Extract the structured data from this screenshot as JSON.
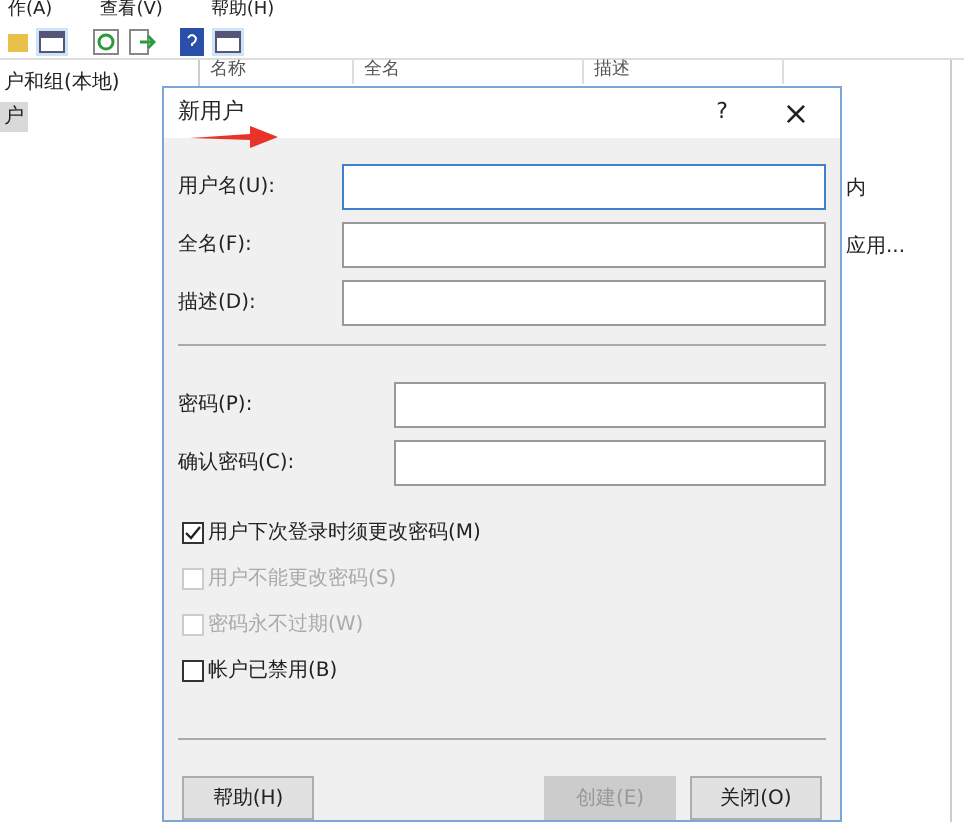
{
  "menu": [
    "作(A)",
    "查看(V)",
    "帮助(H)"
  ],
  "tree": [
    {
      "label": "户和组(本地)",
      "selected": false
    },
    {
      "label": "户",
      "selected": true
    }
  ],
  "list": {
    "columns": [
      "名称",
      "全名",
      "描述"
    ],
    "cells": [
      "内",
      "应用..."
    ]
  },
  "dialog": {
    "title": "新用户",
    "help": "?",
    "close": "×",
    "account_fields": [
      {
        "label": "用户名(U):",
        "focused": true
      },
      {
        "label": "全名(F):",
        "focused": false
      },
      {
        "label": "描述(D):",
        "focused": false
      }
    ],
    "password_fields": [
      {
        "label": "密码(P):",
        "focused": false
      },
      {
        "label": "确认密码(C):",
        "focused": false
      }
    ],
    "options": [
      {
        "label": "用户下次登录时须更改密码(M)",
        "checked": true,
        "disabled": false
      },
      {
        "label": "用户不能更改密码(S)",
        "checked": false,
        "disabled": true
      },
      {
        "label": "密码永不过期(W)",
        "checked": false,
        "disabled": true
      },
      {
        "label": "帐户已禁用(B)",
        "checked": false,
        "disabled": false
      }
    ],
    "help_button": {
      "label": "帮助(H)",
      "disabled": false
    },
    "buttons": [
      {
        "label": "创建(E)",
        "disabled": true
      },
      {
        "label": "关闭(O)",
        "disabled": false
      }
    ]
  }
}
